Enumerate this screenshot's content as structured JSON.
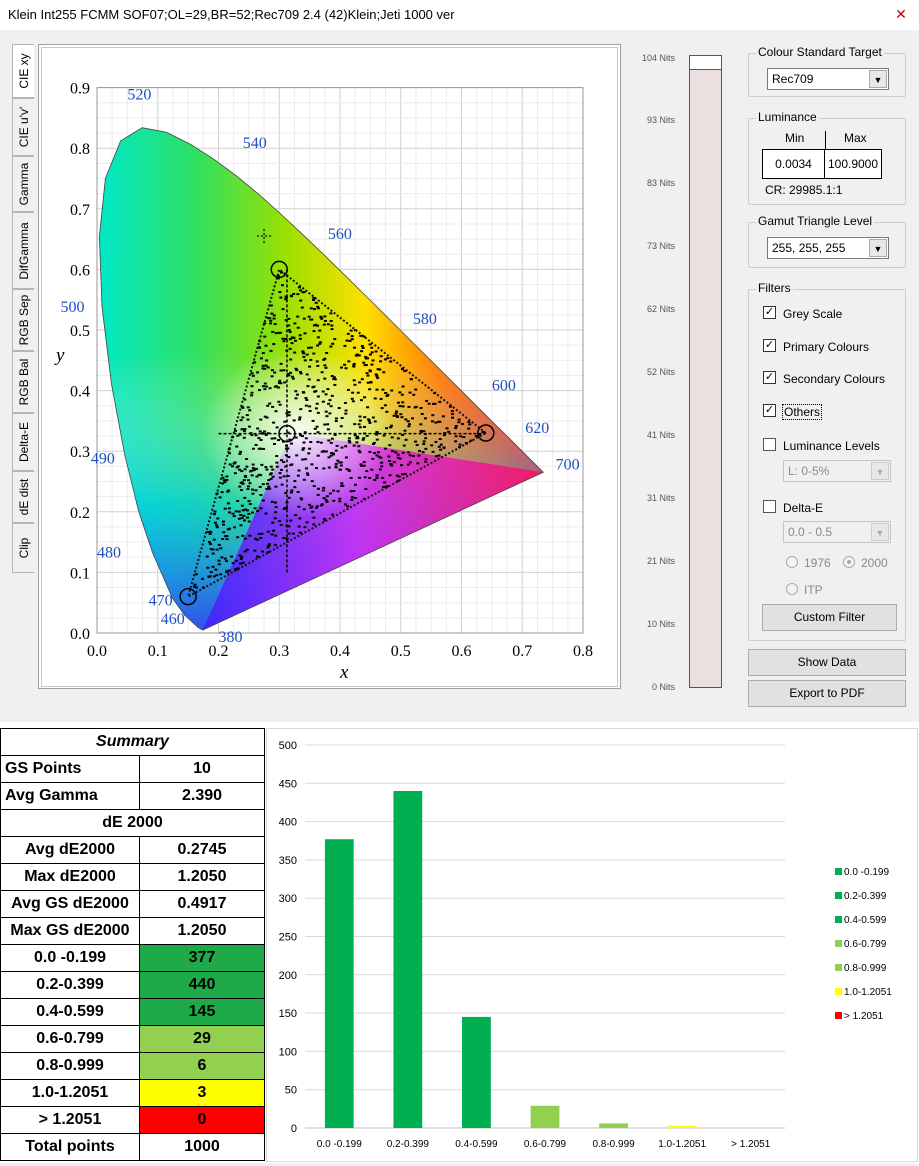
{
  "window": {
    "title": "Klein Int255 FCMM SOF07;OL=29,BR=52;Rec709 2.4 (42)Klein;Jeti 1000 ver",
    "close_icon": "close-icon"
  },
  "tabs": [
    "CIE xy",
    "CIE u'v'",
    "Gamma",
    "DifGamma",
    "RGB Sep",
    "RGB Bal",
    "Delta-E",
    "dE dist",
    "Clip"
  ],
  "cie": {
    "x_label": "x",
    "y_label": "y",
    "x_ticks": [
      "0.0",
      "0.1",
      "0.2",
      "0.3",
      "0.4",
      "0.5",
      "0.6",
      "0.7",
      "0.8"
    ],
    "y_ticks": [
      "0.0",
      "0.1",
      "0.2",
      "0.3",
      "0.4",
      "0.5",
      "0.6",
      "0.7",
      "0.8",
      "0.9"
    ],
    "wavelengths": [
      "380",
      "460",
      "470",
      "480",
      "490",
      "500",
      "520",
      "540",
      "560",
      "580",
      "600",
      "620",
      "700"
    ],
    "gamut_triangle": {
      "red": [
        0.64,
        0.33
      ],
      "green": [
        0.3,
        0.6
      ],
      "blue": [
        0.15,
        0.06
      ],
      "white": [
        0.3127,
        0.329
      ]
    }
  },
  "nits": {
    "labels": [
      "104 Nits",
      "93 Nits",
      "83 Nits",
      "73 Nits",
      "62 Nits",
      "52 Nits",
      "41 Nits",
      "31 Nits",
      "21 Nits",
      "10 Nits",
      "0 Nits"
    ],
    "bar_fraction": 0.98
  },
  "controls": {
    "colour_standard": {
      "title": "Colour Standard Target",
      "value": "Rec709"
    },
    "luminance": {
      "title": "Luminance",
      "min_label": "Min",
      "max_label": "Max",
      "min": "0.0034",
      "max": "100.9000",
      "cr": "CR: 29985.1:1"
    },
    "gamut": {
      "title": "Gamut Triangle Level",
      "value": "255, 255, 255"
    },
    "filters": {
      "title": "Filters",
      "grey_scale": "Grey Scale",
      "primary": "Primary Colours",
      "secondary": "Secondary Colours",
      "others": "Others",
      "lum_levels": "Luminance Levels",
      "lum_levels_value": "L:   0-5%",
      "delta_e": "Delta-E",
      "delta_e_value": "0.0 - 0.5",
      "r1976": "1976",
      "r2000": "2000",
      "itp": "ITP",
      "custom": "Custom Filter"
    },
    "show_data": "Show Data",
    "export_pdf": "Export to PDF"
  },
  "summary": {
    "title": "Summary",
    "gs_points_label": "GS Points",
    "gs_points": "10",
    "avg_gamma_label": "Avg Gamma",
    "avg_gamma": "2.390",
    "de_header": "dE 2000",
    "avg_de_label": "Avg dE2000",
    "avg_de": "0.2745",
    "max_de_label": "Max dE2000",
    "max_de": "1.2050",
    "avg_gs_de_label": "Avg GS dE2000",
    "avg_gs_de": "0.4917",
    "max_gs_de_label": "Max GS dE2000",
    "max_gs_de": "1.2050",
    "bins": [
      {
        "label": "0.0 -0.199",
        "value": "377",
        "color": "#1faa4a"
      },
      {
        "label": "0.2-0.399",
        "value": "440",
        "color": "#1faa4a"
      },
      {
        "label": "0.4-0.599",
        "value": "145",
        "color": "#1faa4a"
      },
      {
        "label": "0.6-0.799",
        "value": "29",
        "color": "#92d050"
      },
      {
        "label": "0.8-0.999",
        "value": "6",
        "color": "#92d050"
      },
      {
        "label": "1.0-1.2051",
        "value": "3",
        "color": "#ffff00"
      },
      {
        "label": "> 1.2051",
        "value": "0",
        "color": "#ff0000"
      }
    ],
    "total_label": "Total points",
    "total": "1000"
  },
  "chart_data": {
    "type": "bar",
    "categories": [
      "0.0 -0.199",
      "0.2-0.399",
      "0.4-0.599",
      "0.6-0.799",
      "0.8-0.999",
      "1.0-1.2051",
      "> 1.2051"
    ],
    "values": [
      377,
      440,
      145,
      29,
      6,
      3,
      0
    ],
    "colors": [
      "#00b050",
      "#00b050",
      "#00b050",
      "#92d050",
      "#92d050",
      "#ffff00",
      "#ff0000"
    ],
    "legend": [
      "0.0 -0.199",
      "0.2-0.399",
      "0.4-0.599",
      "0.6-0.799",
      "0.8-0.999",
      "1.0-1.2051",
      "> 1.2051"
    ],
    "legend_colors": [
      "#00b050",
      "#00b050",
      "#00b050",
      "#92d050",
      "#92d050",
      "#ffff00",
      "#ff0000"
    ],
    "legend_position": "right",
    "ylim": [
      0,
      500
    ],
    "y_ticks": [
      "0",
      "50",
      "100",
      "150",
      "200",
      "250",
      "300",
      "350",
      "400",
      "450",
      "500"
    ],
    "grid": true
  }
}
